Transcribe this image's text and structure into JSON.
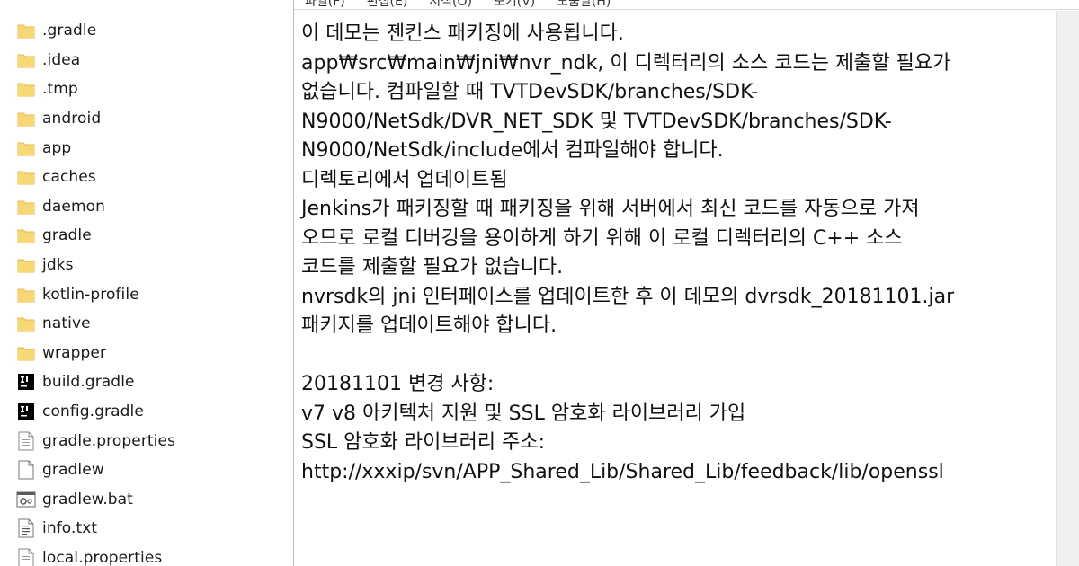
{
  "explorer": {
    "items": [
      {
        "name": ".gradle",
        "icon": "folder-icon"
      },
      {
        "name": ".idea",
        "icon": "folder-icon"
      },
      {
        "name": ".tmp",
        "icon": "folder-icon"
      },
      {
        "name": "android",
        "icon": "folder-icon"
      },
      {
        "name": "app",
        "icon": "folder-icon"
      },
      {
        "name": "caches",
        "icon": "folder-icon"
      },
      {
        "name": "daemon",
        "icon": "folder-icon"
      },
      {
        "name": "gradle",
        "icon": "folder-icon"
      },
      {
        "name": "jdks",
        "icon": "folder-icon"
      },
      {
        "name": "kotlin-profile",
        "icon": "folder-icon"
      },
      {
        "name": "native",
        "icon": "folder-icon"
      },
      {
        "name": "wrapper",
        "icon": "folder-icon"
      },
      {
        "name": "build.gradle",
        "icon": "intellij-file-icon"
      },
      {
        "name": "config.gradle",
        "icon": "intellij-file-icon"
      },
      {
        "name": "gradle.properties",
        "icon": "properties-file-icon"
      },
      {
        "name": "gradlew",
        "icon": "blank-file-icon"
      },
      {
        "name": "gradlew.bat",
        "icon": "batch-file-icon"
      },
      {
        "name": "info.txt",
        "icon": "text-file-icon"
      },
      {
        "name": "local.properties",
        "icon": "properties-file-icon"
      }
    ]
  },
  "notepad": {
    "menu": [
      "파일(F)",
      "편집(E)",
      "서식(O)",
      "보기(V)",
      "도움말(H)"
    ],
    "lines": [
      "이 데모는 젠킨스 패키징에 사용됩니다.",
      "app₩src₩main₩jni₩nvr_ndk, 이 디렉터리의 소스 코드는 제출할 필요가",
      "없습니다. 컴파일할 때 TVTDevSDK/branches/SDK-",
      "N9000/NetSdk/DVR_NET_SDK 및 TVTDevSDK/branches/SDK-",
      "N9000/NetSdk/include에서 컴파일해야 합니다.",
      "디렉토리에서 업데이트됨",
      "Jenkins가 패키징할 때 패키징을 위해 서버에서 최신 코드를 자동으로 가져",
      "오므로 로컬 디버깅을 용이하게 하기 위해 이 로컬 디렉터리의 C++ 소스",
      "코드를 제출할 필요가 없습니다.",
      "nvrsdk의 jni 인터페이스를 업데이트한 후 이 데모의 dvrsdk_20181101.jar",
      "패키지를 업데이트해야 합니다.",
      "",
      "20181101 변경 사항:",
      "v7 v8 아키텍처 지원 및 SSL 암호화 라이브러리 가입",
      "SSL 암호화 라이브러리 주소:",
      "http://xxxip/svn/APP_Shared_Lib/Shared_Lib/feedback/lib/openssl"
    ]
  },
  "colors": {
    "folder": "#f8d775",
    "folder_dark": "#e8b84a",
    "text": "#111111"
  }
}
